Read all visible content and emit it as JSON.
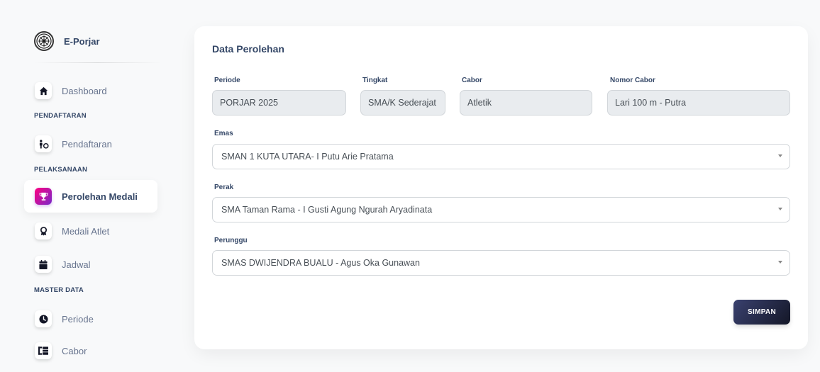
{
  "brand": {
    "name": "E-Porjar",
    "logo_icon": "emblem-icon"
  },
  "sidebar": {
    "items": [
      {
        "label": "Dashboard",
        "icon": "home-icon"
      },
      {
        "label": "Pendaftaran",
        "icon": "person-register-icon"
      },
      {
        "label": "Perolehan Medali",
        "icon": "trophy-icon",
        "active": true
      },
      {
        "label": "Medali Atlet",
        "icon": "medal-icon"
      },
      {
        "label": "Jadwal",
        "icon": "calendar-icon"
      },
      {
        "label": "Periode",
        "icon": "clock-icon"
      },
      {
        "label": "Cabor",
        "icon": "sitemap-icon"
      }
    ],
    "sections": [
      "PENDAFTARAN",
      "PELAKSANAAN",
      "MASTER DATA"
    ]
  },
  "form": {
    "title": "Data Perolehan",
    "periode": {
      "label": "Periode",
      "value": "PORJAR 2025"
    },
    "tingkat": {
      "label": "Tingkat",
      "value": "SMA/K Sederajat"
    },
    "cabor": {
      "label": "Cabor",
      "value": "Atletik"
    },
    "nomor_cabor": {
      "label": "Nomor Cabor",
      "value": "Lari 100 m - Putra"
    },
    "emas": {
      "label": "Emas",
      "value": "SMAN 1 KUTA UTARA- I Putu Arie Pratama"
    },
    "perak": {
      "label": "Perak",
      "value": "SMA Taman Rama - I Gusti Agung Ngurah Aryadinata"
    },
    "perunggu": {
      "label": "Perunggu",
      "value": "SMAS DWIJENDRA BUALU - Agus Oka Gunawan"
    },
    "save_label": "SIMPAN"
  },
  "colors": {
    "active_icon_gradient_start": "#7928ca",
    "active_icon_gradient_end": "#ff0080",
    "button_dark": "#141727",
    "text_primary": "#344767"
  }
}
